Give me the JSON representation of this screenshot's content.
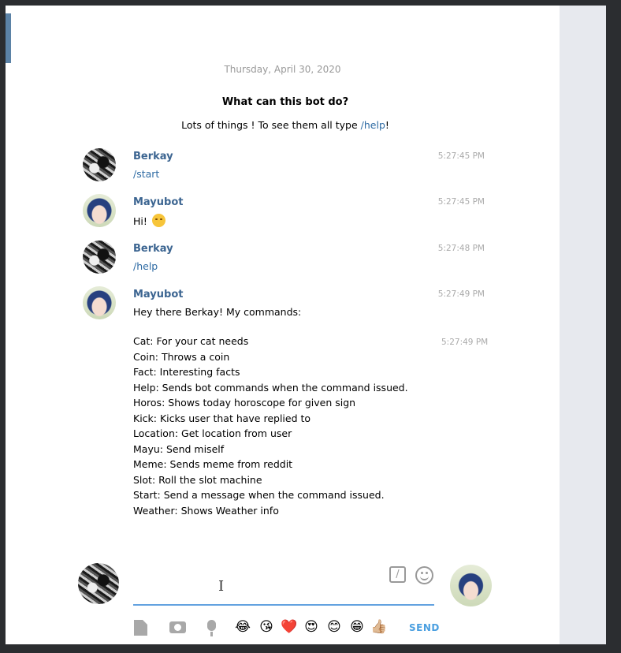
{
  "chat": {
    "date_separator": "Thursday, April 30, 2020",
    "bot_info": {
      "title": "What can this bot do?",
      "description_prefix": "Lots of things ! To see them all type ",
      "description_link": "/help",
      "description_suffix": "!"
    },
    "messages": [
      {
        "sender": "Berkay",
        "time": "5:27:45 PM",
        "text": "/start"
      },
      {
        "sender": "Mayubot",
        "time": "5:27:45 PM",
        "text": "Hi!"
      },
      {
        "sender": "Berkay",
        "time": "5:27:48 PM",
        "text": "/help"
      },
      {
        "sender": "Mayubot",
        "time": "5:27:49 PM",
        "text": "Hey there Berkay! My commands:"
      }
    ],
    "commands_time": "5:27:49 PM",
    "commands": [
      "Cat:  For your cat needs",
      "Coin: Throws a coin",
      "Fact:  Interesting facts",
      "Help: Sends bot commands when the command issued.",
      "Horos: Shows today horoscope for given sign",
      "Kick: Kicks user that have replied to",
      "Location: Get location from user",
      "Mayu: Send miself",
      "Meme: Sends meme from reddit",
      "Slot:  Roll the slot machine",
      "Start: Send a message when the command issued.",
      "Weather: Shows Weather info"
    ]
  },
  "composer": {
    "input_value": "",
    "send_label": "SEND",
    "quick_emojis": [
      "😂",
      "😘",
      "❤️",
      "😍",
      "😊",
      "😁",
      "👍🏼"
    ]
  },
  "icons": {
    "attach": "file-icon",
    "camera": "camera-icon",
    "voice": "microphone-icon",
    "commands": "slash-command-icon",
    "emoji": "smile-icon"
  },
  "colors": {
    "sender_name": "#3c6591",
    "link": "#2d6aa3",
    "accent_underline": "#63a2e0",
    "send": "#4a9fe0"
  }
}
